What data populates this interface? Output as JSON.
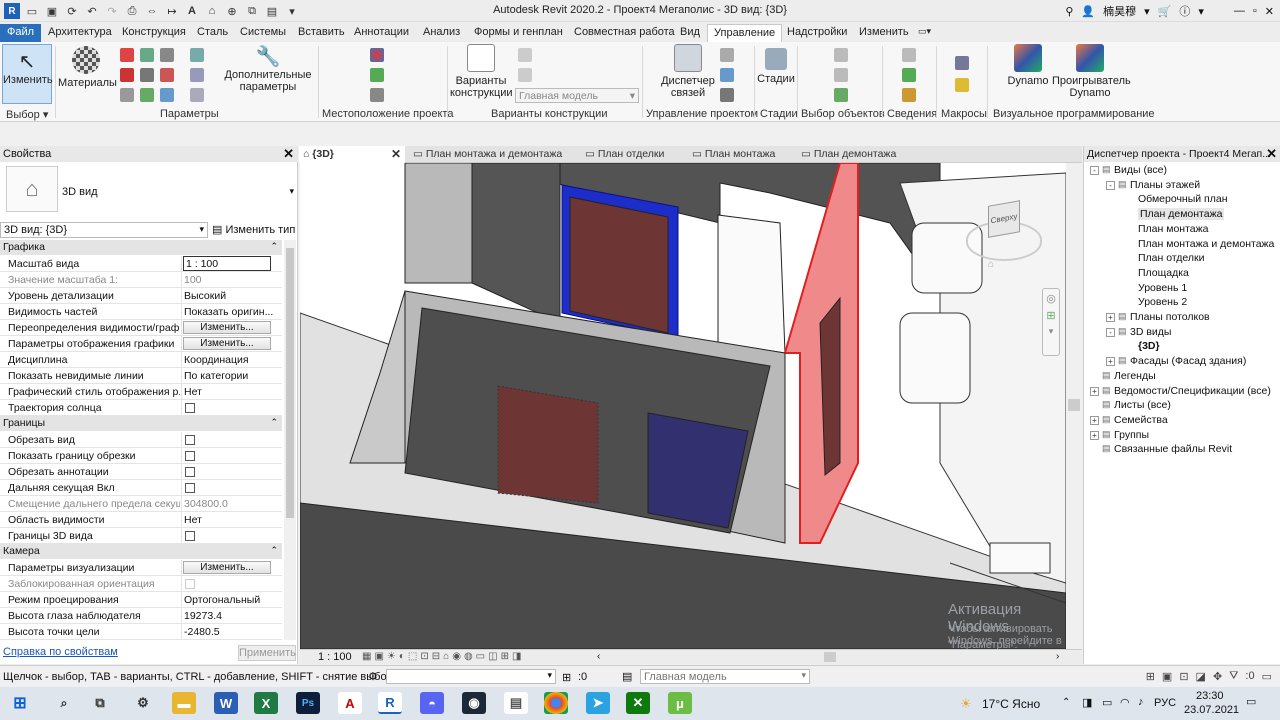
{
  "window_title": "Autodesk Revit 2020.2 - Проект4 Мегаполис - 3D вид: {3D}",
  "user_name": "楠昊穆",
  "ribbon_tabs": [
    "Файл",
    "Архитектура",
    "Конструкция",
    "Сталь",
    "Системы",
    "Вставить",
    "Аннотации",
    "Анализ",
    "Формы и генплан",
    "Совместная работа",
    "Вид",
    "Управление",
    "Надстройки",
    "Изменить"
  ],
  "active_tab": "Управление",
  "ribbon": {
    "modify": "Изменить",
    "materials": "Материалы",
    "additional_params": "Дополнительные параметры",
    "design_options": "Варианты конструкции",
    "main_model": "Главная модель",
    "link_manager": "Диспетчер связей",
    "phases": "Стадии",
    "dynamo": "Dynamo",
    "dynamo_player": "Проигрыватель Dynamo",
    "panels": {
      "select": "Выбор",
      "settings": "Параметры",
      "location": "Местоположение проекта",
      "design_options": "Варианты конструкции",
      "manage_project": "Управление проектом",
      "phasing": "Стадии",
      "selection": "Выбор объектов",
      "inquiry": "Сведения",
      "macros": "Макросы",
      "visual_programming": "Визуальное программирование"
    }
  },
  "properties": {
    "title": "Свойства",
    "type_name": "3D вид",
    "instance_selector": "3D вид: {3D}",
    "edit_type": "Изменить тип",
    "help_link": "Справка по свойствам",
    "apply": "Применить",
    "edit_label": "Изменить...",
    "groups": {
      "graphics": "Графика",
      "extents": "Границы",
      "camera": "Камера"
    },
    "graphics_rows": [
      {
        "k": "Масштаб вида",
        "v": "1 : 100"
      },
      {
        "k": "Значение масштаба    1:",
        "v": "100"
      },
      {
        "k": "Уровень детализации",
        "v": "Высокий"
      },
      {
        "k": "Видимость частей",
        "v": "Показать оригин..."
      },
      {
        "k": "Переопределения видимости/граф...",
        "v": ""
      },
      {
        "k": "Параметры отображения графики",
        "v": ""
      },
      {
        "k": "Дисциплина",
        "v": "Координация"
      },
      {
        "k": "Показать невидимые линии",
        "v": "По категории"
      },
      {
        "k": "Графический стиль отображения р...",
        "v": "Нет"
      },
      {
        "k": "Траектория солнца",
        "v": ""
      }
    ],
    "extents_rows": [
      {
        "k": "Обрезать вид",
        "v": ""
      },
      {
        "k": "Показать границу обрезки",
        "v": ""
      },
      {
        "k": "Обрезать аннотации",
        "v": ""
      },
      {
        "k": "Дальняя секущая Вкл",
        "v": ""
      },
      {
        "k": "Смещение дальнего предела секущ...",
        "v": "304800.0"
      },
      {
        "k": "Область видимости",
        "v": "Нет"
      },
      {
        "k": "Границы 3D вида",
        "v": ""
      }
    ],
    "camera_rows": [
      {
        "k": "Параметры визуализации",
        "v": ""
      },
      {
        "k": "Заблокированная ориентация",
        "v": ""
      },
      {
        "k": "Режим проецирования",
        "v": "Ортогональный"
      },
      {
        "k": "Высота глаза наблюдателя",
        "v": "19273.4"
      },
      {
        "k": "Высота точки цели",
        "v": "-2480.5"
      }
    ]
  },
  "doc_tabs": [
    "{3D}",
    "План монтажа и демонтажа",
    "План отделки",
    "План монтажа",
    "План демонтажа"
  ],
  "viewcube_label": "Сверху",
  "view_scale": "1 : 100",
  "browser": {
    "title": "Диспетчер проекта - Проект4 Мегап...",
    "items": [
      {
        "t": "Виды (все)",
        "lvl": 0,
        "exp": "-"
      },
      {
        "t": "Планы этажей",
        "lvl": 1,
        "exp": "-"
      },
      {
        "t": "Обмерочный план",
        "lvl": 2
      },
      {
        "t": "План демонтажа",
        "lvl": 2,
        "sel": true
      },
      {
        "t": "План монтажа",
        "lvl": 2
      },
      {
        "t": "План монтажа и демонтажа",
        "lvl": 2
      },
      {
        "t": "План отделки",
        "lvl": 2
      },
      {
        "t": "Площадка",
        "lvl": 2
      },
      {
        "t": "Уровень 1",
        "lvl": 2
      },
      {
        "t": "Уровень 2",
        "lvl": 2
      },
      {
        "t": "Планы потолков",
        "lvl": 1,
        "exp": "+"
      },
      {
        "t": "3D виды",
        "lvl": 1,
        "exp": "-"
      },
      {
        "t": "{3D}",
        "lvl": 2,
        "bold": true
      },
      {
        "t": "Фасады (Фасад здания)",
        "lvl": 1,
        "exp": "+"
      },
      {
        "t": "Легенды",
        "lvl": 0
      },
      {
        "t": "Ведомости/Спецификации (все)",
        "lvl": 0,
        "exp": "+"
      },
      {
        "t": "Листы (все)",
        "lvl": 0
      },
      {
        "t": "Семейства",
        "lvl": 0,
        "exp": "+"
      },
      {
        "t": "Группы",
        "lvl": 0,
        "exp": "+"
      },
      {
        "t": "Связанные файлы Revit",
        "lvl": 0
      }
    ]
  },
  "status": {
    "hint": "Щелчок - выбор, TAB - варианты, CTRL - добавление, SHIFT - снятие выбора.",
    "zero": ":0",
    "main_model": "Главная модель",
    "filter_count": ":0"
  },
  "watermark": {
    "line1": "Активация Windows",
    "line2": "Чтобы активировать Windows, перейдите в раздел",
    "line3": "\"Параметры\"."
  },
  "taskbar": {
    "weather": "17°C Ясно",
    "lang": "РУС",
    "time": "23:30",
    "date": "23.07.2021"
  }
}
